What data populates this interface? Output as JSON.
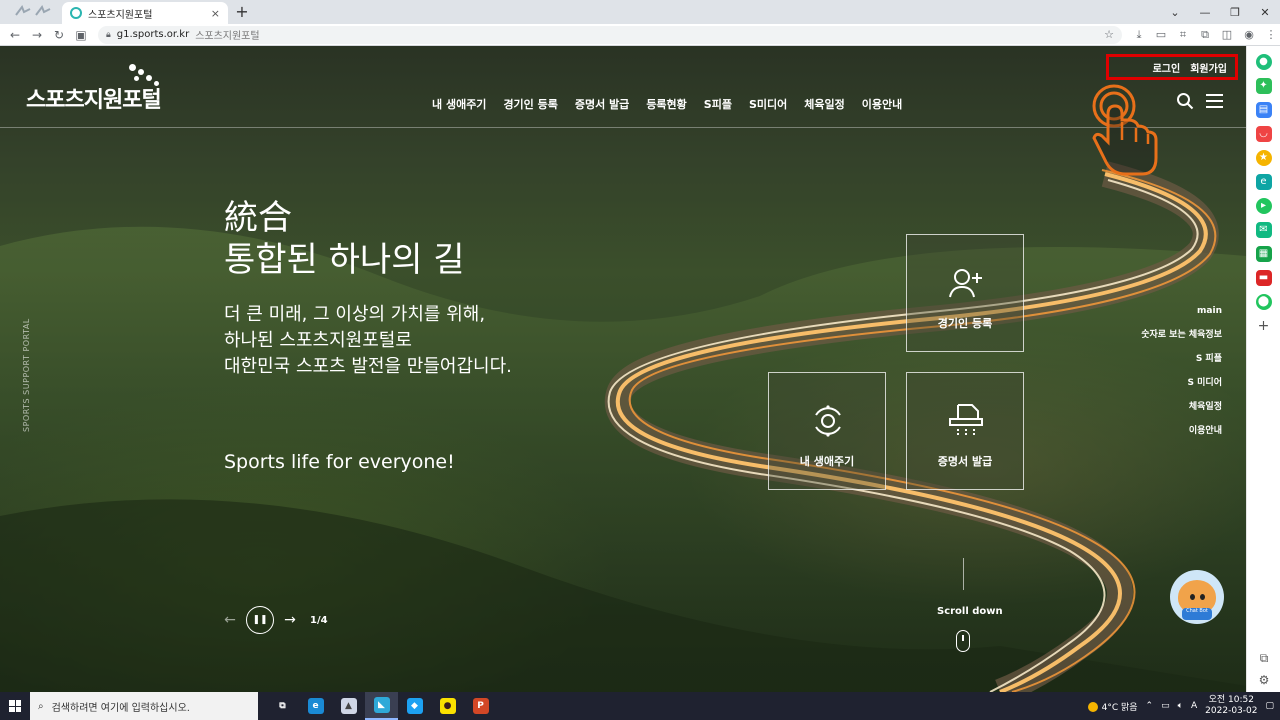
{
  "browser": {
    "tab_title": "스포츠지원포털",
    "tab_close": "×",
    "new_tab": "+",
    "url": "g1.sports.or.kr",
    "page_title": "스포츠지원포털"
  },
  "site": {
    "logo_text": "스포츠지원포털",
    "gnb": [
      "내 생애주기",
      "경기인 등록",
      "증명서 발급",
      "등록현황",
      "S피플",
      "S미디어",
      "체육일정",
      "이용안내"
    ],
    "login": "로그인",
    "signup": "회원가입",
    "side_vertical": "SPORTS SUPPORT PORTAL"
  },
  "hero": {
    "kanji": "統合",
    "title": "통합된 하나의 길",
    "desc_lines": [
      "더 큰 미래, 그 이상의 가치를 위해,",
      "하나된 스포츠지원포털로",
      "대한민국 스포츠 발전을 만들어갑니다."
    ],
    "slogan": "Sports life for everyone!",
    "slide_count": "1/4",
    "scroll_label": "Scroll down"
  },
  "quick_cards": {
    "athlete_register": "경기인 등록",
    "my_lifecycle": "내 생애주기",
    "certificate": "증명서 발급"
  },
  "side_nav": [
    "main",
    "숫자로 보는 체육정보",
    "S 피플",
    "S 미디어",
    "체육일정",
    "이용안내"
  ],
  "chatbot": {
    "label": "Chat Bot"
  },
  "taskbar": {
    "search_placeholder": "검색하려면 여기에 입력하십시오.",
    "weather": "4°C 맑음",
    "time": "오전 10:52",
    "date": "2022-03-02"
  },
  "colors": {
    "highlight_box": "#e00000",
    "hand_cursor": "#e8701a",
    "taskbar_bg": "#1f2230"
  }
}
